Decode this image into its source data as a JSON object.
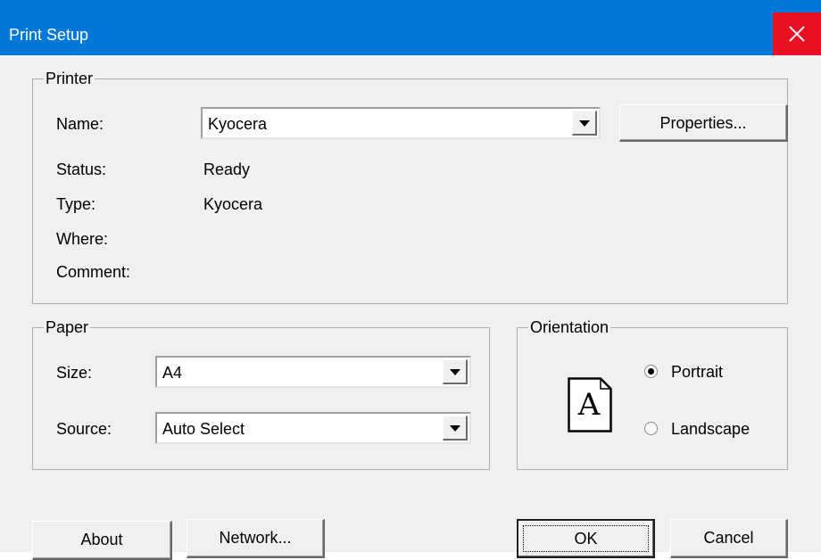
{
  "window": {
    "title": "Print Setup",
    "close_icon": "close-icon",
    "accent": "#0078d7",
    "close_color": "#e81123"
  },
  "printer": {
    "legend": "Printer",
    "name_label": "Name:",
    "name_value": "Kyocera",
    "properties_label": "Properties...",
    "status_label": "Status:",
    "status_value": "Ready",
    "type_label": "Type:",
    "type_value": "Kyocera",
    "where_label": "Where:",
    "where_value": "",
    "comment_label": "Comment:",
    "comment_value": ""
  },
  "paper": {
    "legend": "Paper",
    "size_label": "Size:",
    "size_value": "A4",
    "source_label": "Source:",
    "source_value": "Auto Select"
  },
  "orientation": {
    "legend": "Orientation",
    "page_icon": "portrait-page-icon",
    "page_glyph": "A",
    "portrait_label": "Portrait",
    "landscape_label": "Landscape",
    "selected": "Portrait"
  },
  "buttons": {
    "about": "About",
    "network": "Network...",
    "ok": "OK",
    "cancel": "Cancel"
  }
}
